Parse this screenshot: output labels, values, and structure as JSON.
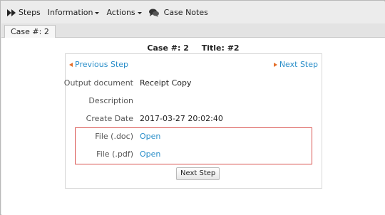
{
  "menubar": {
    "steps_label": "Steps",
    "information_label": "Information",
    "actions_label": "Actions",
    "case_notes_label": "Case Notes"
  },
  "tabs": [
    {
      "label": "Case #: 2"
    }
  ],
  "case_header": {
    "case_label": "Case #: 2",
    "title_label": "Title: #2"
  },
  "step_nav": {
    "previous": "Previous Step",
    "next": "Next Step"
  },
  "fields": [
    {
      "label": "Output document",
      "value": "Receipt Copy"
    },
    {
      "label": "Description",
      "value": ""
    },
    {
      "label": "Create Date",
      "value": "2017-03-27 20:02:40"
    },
    {
      "label": "File (.doc)",
      "value": "Open"
    },
    {
      "label": "File (.pdf)",
      "value": "Open"
    }
  ],
  "buttons": {
    "next_step": "Next Step"
  },
  "colors": {
    "link": "#2a8ec9",
    "arrow": "#e46f2a",
    "highlight_border": "#d9534f"
  }
}
